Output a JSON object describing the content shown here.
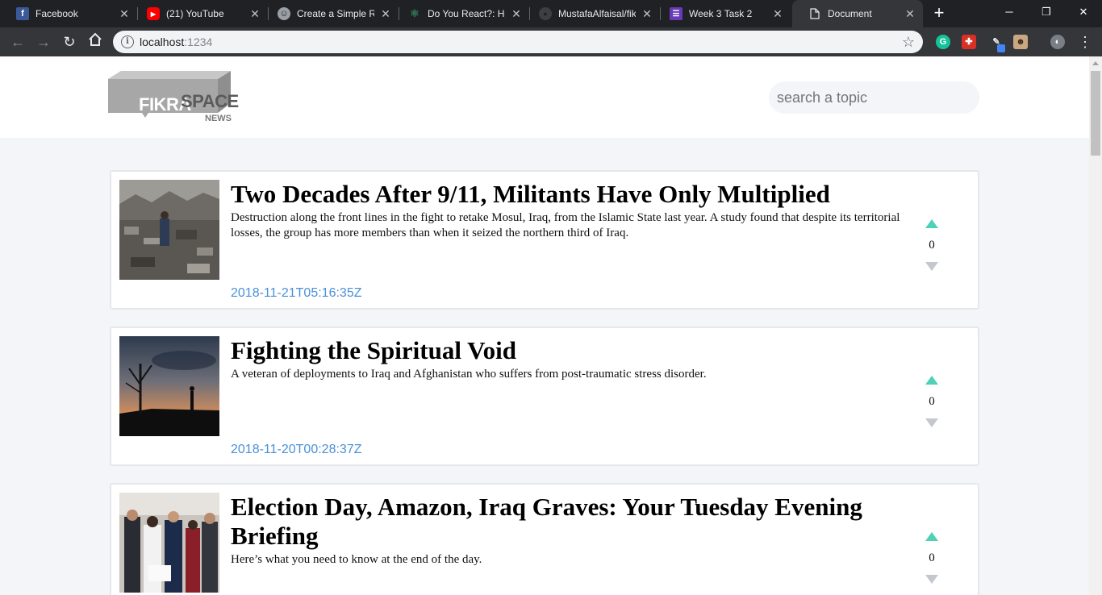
{
  "browser": {
    "tabs": [
      {
        "title": "Facebook",
        "icon": "facebook-icon",
        "color": "#3b5998",
        "glyph": "f"
      },
      {
        "title": "(21) YouTube",
        "icon": "youtube-icon",
        "color": "#ff0000",
        "glyph": "▶"
      },
      {
        "title": "Create a Simple Re",
        "icon": "avatar-icon",
        "color": "#9aa0a6",
        "glyph": "☺"
      },
      {
        "title": "Do You React?: He",
        "icon": "react-icon",
        "color": "#2a2d31",
        "glyph": "⚛"
      },
      {
        "title": "MustafaAlfaisal/fik",
        "icon": "github-icon",
        "color": "#3c4043",
        "glyph": "●"
      },
      {
        "title": "Week 3 Task 2",
        "icon": "list-icon",
        "color": "#673ab7",
        "glyph": "☰"
      },
      {
        "title": "Document",
        "icon": "document-icon",
        "color": "#35363a",
        "glyph": "🗋"
      }
    ],
    "address": {
      "host": "localhost",
      "port": ":1234"
    }
  },
  "site": {
    "logo": {
      "word1": "FIKRA",
      "word2": "SPACE",
      "sub": "NEWS"
    },
    "search_placeholder": "search a topic",
    "colors": {
      "upvote": "#4fd1b8",
      "downvote": "#c4c7cc",
      "date": "#4a90d9"
    }
  },
  "articles": [
    {
      "title": "Two Decades After 9/11, Militants Have Only Multiplied",
      "description": "Destruction along the front lines in the fight to retake Mosul, Iraq, from the Islamic State last year. A study found that despite its territorial losses, the group has more members than when it seized the northern third of Iraq.",
      "date": "2018-11-21T05:16:35Z",
      "votes": "0",
      "image": "rubble-photo"
    },
    {
      "title": "Fighting the Spiritual Void",
      "description": "A veteran of deployments to Iraq and Afghanistan who suffers from post-traumatic stress disorder.",
      "date": "2018-11-20T00:28:37Z",
      "votes": "0",
      "image": "sunset-silhouette-photo"
    },
    {
      "title": "Election Day, Amazon, Iraq Graves: Your Tuesday Evening Briefing",
      "description": "Here’s what you need to know at the end of the day.",
      "date": "",
      "votes": "0",
      "image": "crowd-photo"
    }
  ]
}
